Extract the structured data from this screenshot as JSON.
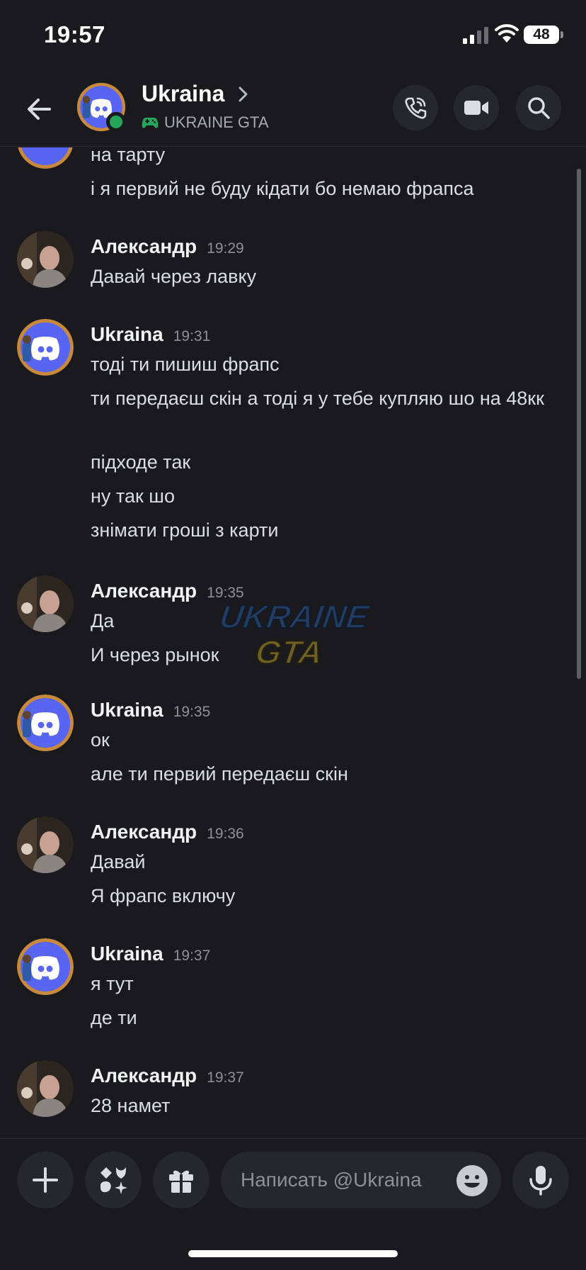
{
  "status_bar": {
    "time": "19:57",
    "battery": "48"
  },
  "header": {
    "name": "Ukraina",
    "subtitle": "UKRAINE GTA",
    "back_icon": "arrow-left-icon",
    "call_icon": "phone-icon",
    "video_icon": "video-camera-icon",
    "search_icon": "search-icon"
  },
  "messages": {
    "g0": {
      "lines": [
        "на тарту",
        "і я первий не буду кідати бо немаю фрапса"
      ]
    },
    "g1": {
      "author": "Александр",
      "time": "19:29",
      "lines": [
        "Давай через лавку"
      ]
    },
    "g2": {
      "author": "Ukraina",
      "time": "19:31",
      "lines": [
        "тоді ти пишиш фрапс",
        "ти передаєш скін а тоді я у тебе купляю шо на 48кк",
        "підходе так",
        "ну так шо",
        "знімати гроші з карти"
      ]
    },
    "g3": {
      "author": "Александр",
      "time": "19:35",
      "lines": [
        "Да",
        "И через рынок"
      ]
    },
    "g4": {
      "author": "Ukraina",
      "time": "19:35",
      "lines": [
        "ок",
        "але ти первий передаєш скін"
      ]
    },
    "g5": {
      "author": "Александр",
      "time": "19:36",
      "lines": [
        "Давай",
        "Я фрапс включу"
      ]
    },
    "g6": {
      "author": "Ukraina",
      "time": "19:37",
      "lines": [
        "я тут",
        "де ти"
      ]
    },
    "g7": {
      "author": "Александр",
      "time": "19:37",
      "lines": [
        "28 намет"
      ]
    }
  },
  "watermark": {
    "line1": "UKRAINE",
    "line2": "GTA"
  },
  "input": {
    "placeholder": "Написать @Ukraina",
    "plus_icon": "plus-icon",
    "apps_icon": "apps-icon",
    "gift_icon": "gift-icon",
    "emoji_icon": "emoji-icon",
    "mic_icon": "microphone-icon"
  },
  "colors": {
    "background": "#1a1a1e",
    "discord_blurple": "#5865f2",
    "online": "#23a55a",
    "game_icon": "#23a55a"
  }
}
